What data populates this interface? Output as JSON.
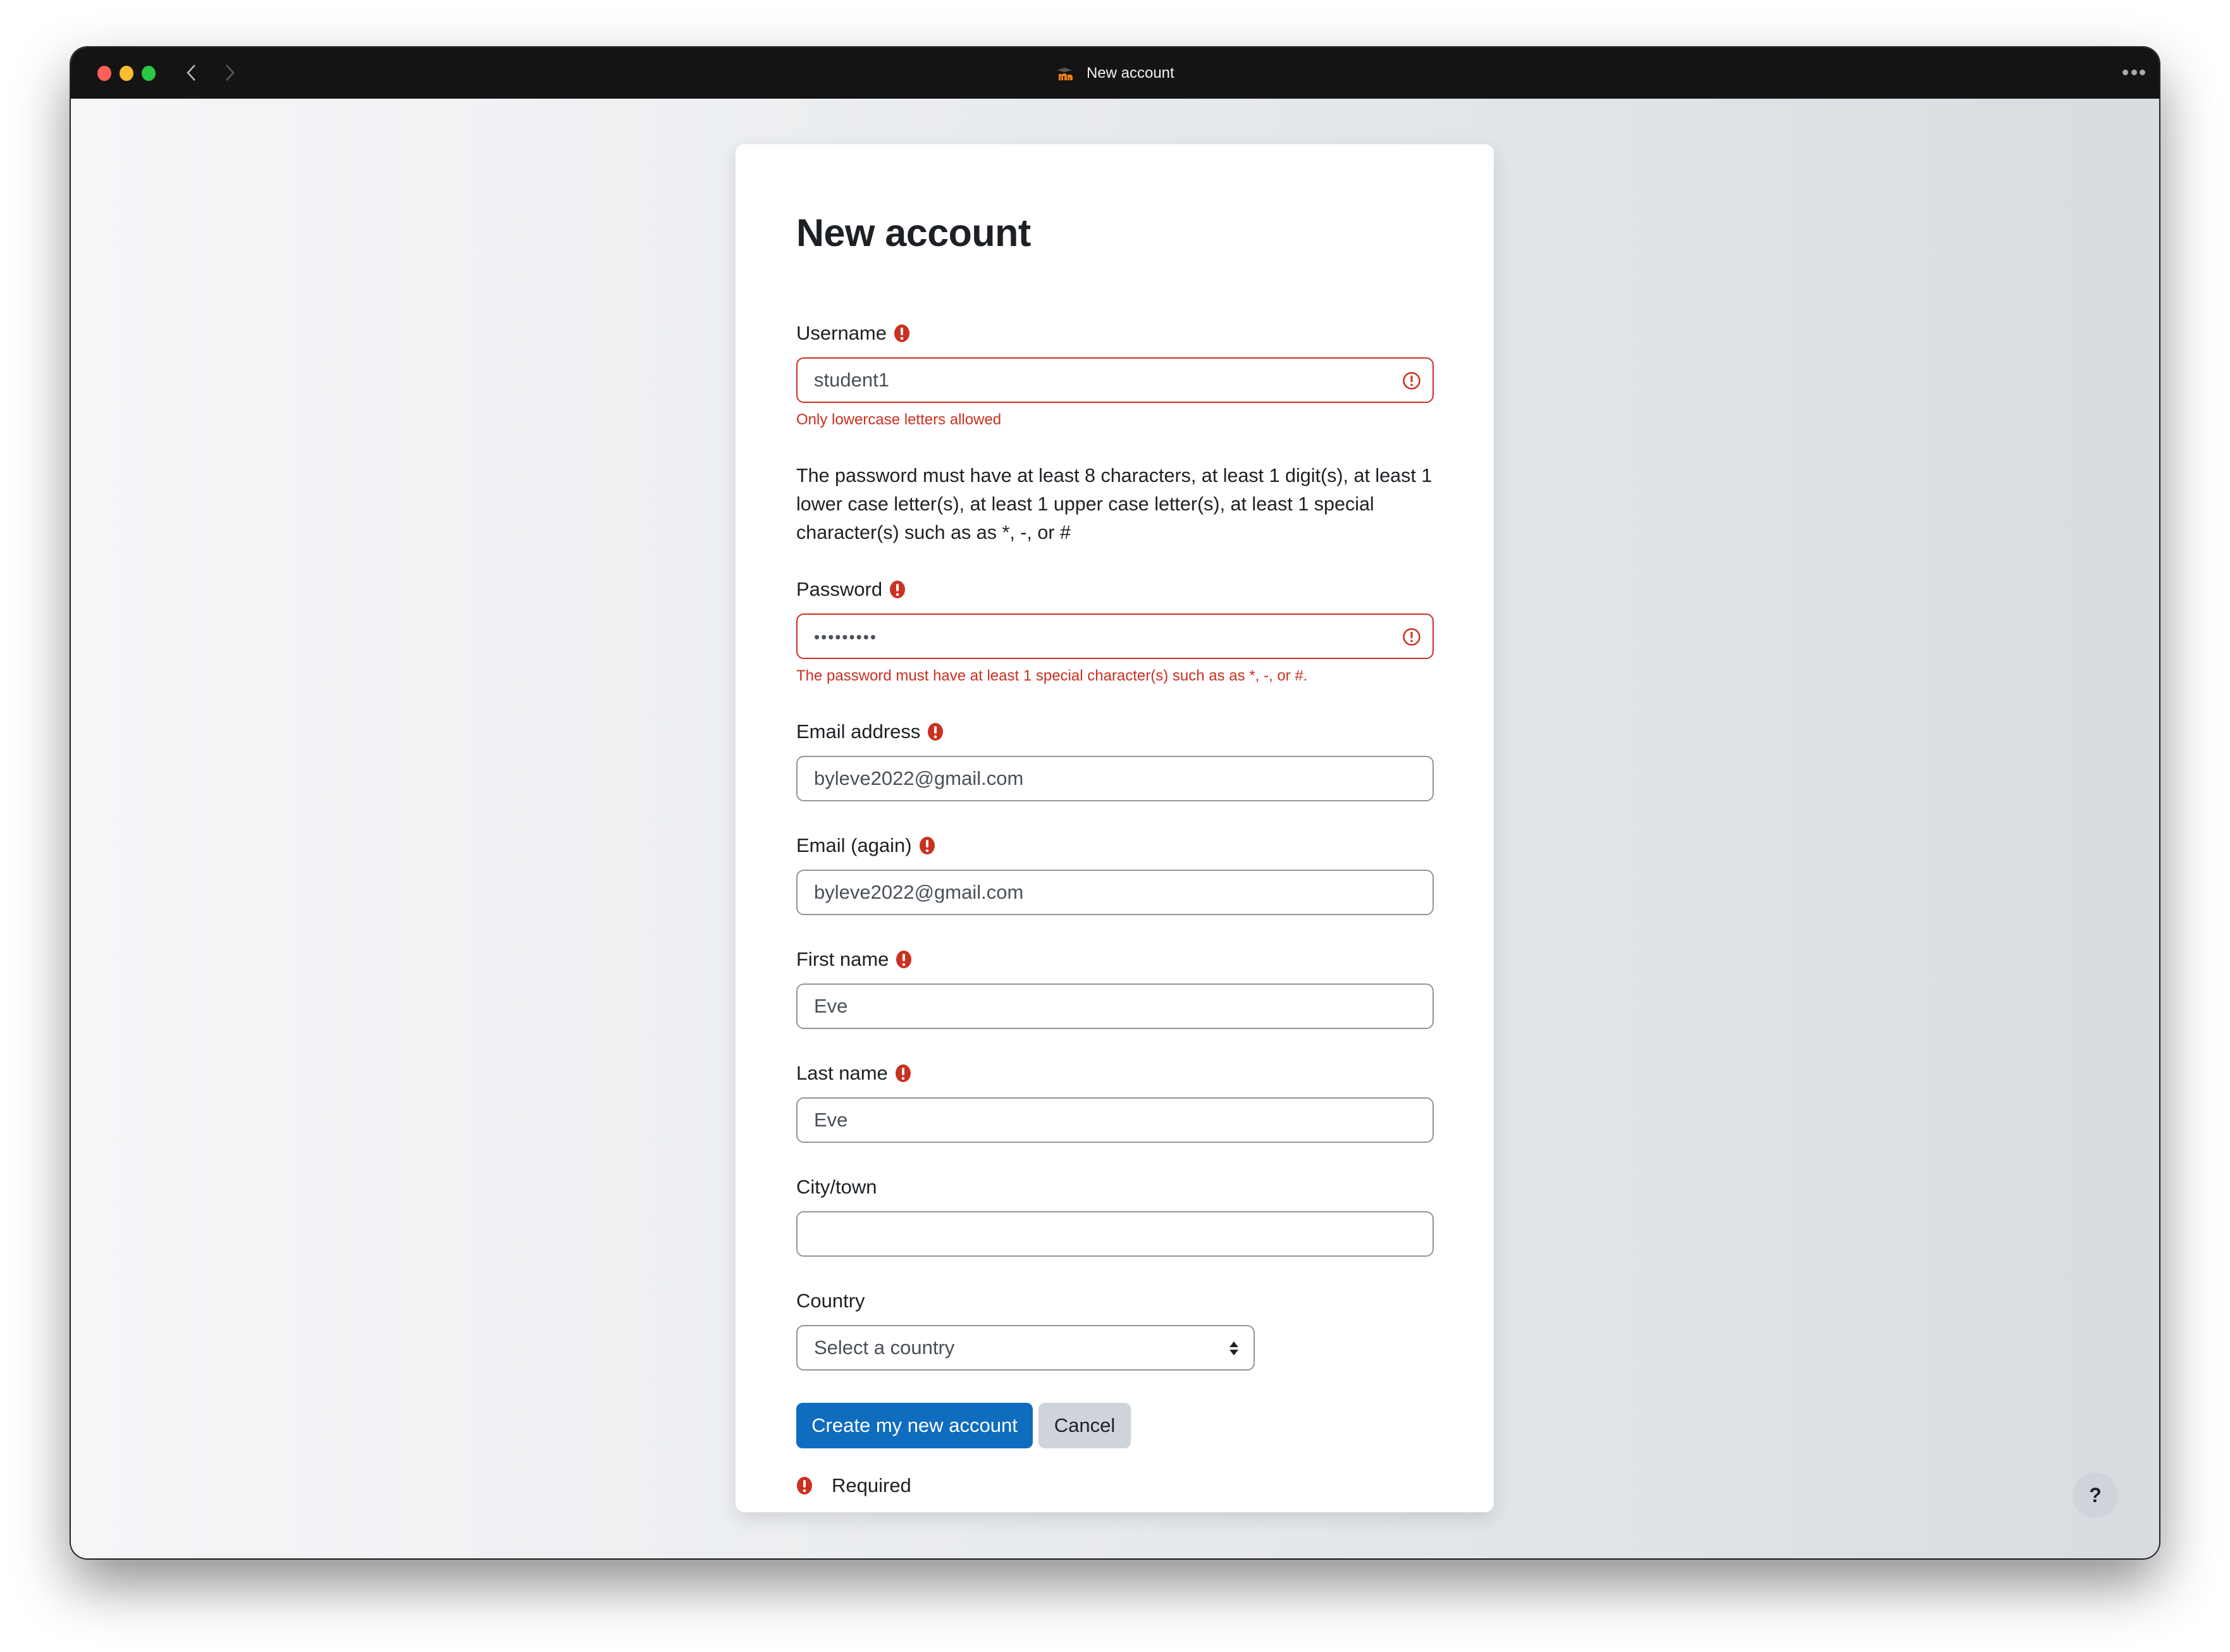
{
  "browser": {
    "tab_title": "New account",
    "logo_icon": "moodle-logo",
    "back_icon": "chevron-left-icon",
    "forward_icon": "chevron-right-icon",
    "menu_icon": "more-horizontal-icon"
  },
  "form": {
    "title": "New account",
    "username": {
      "label": "Username",
      "value": "student1",
      "error": "Only lowercase letters allowed",
      "required": true
    },
    "password_policy": "The password must have at least 8 characters, at least 1 digit(s), at least 1 lower case letter(s), at least 1 upper case letter(s), at least 1 special character(s) such as as *, -, or #",
    "password": {
      "label": "Password",
      "masked_value": "•••••••••",
      "error": "The password must have at least 1 special character(s) such as as *, -, or #.",
      "required": true
    },
    "email": {
      "label": "Email address",
      "value": "byleve2022@gmail.com",
      "required": true
    },
    "email_again": {
      "label": "Email (again)",
      "value": "byleve2022@gmail.com",
      "required": true
    },
    "first_name": {
      "label": "First name",
      "value": "Eve",
      "required": true
    },
    "last_name": {
      "label": "Last name",
      "value": "Eve",
      "required": true
    },
    "city": {
      "label": "City/town",
      "value": ""
    },
    "country": {
      "label": "Country",
      "selected": "Select a country"
    },
    "buttons": {
      "submit": "Create my new account",
      "cancel": "Cancel"
    },
    "required_note": "Required"
  },
  "help_button": "?",
  "colors": {
    "accent": "#0f6cbf",
    "error": "#ca3120",
    "text": "#1d2125",
    "secondary_button": "#ced4da"
  }
}
